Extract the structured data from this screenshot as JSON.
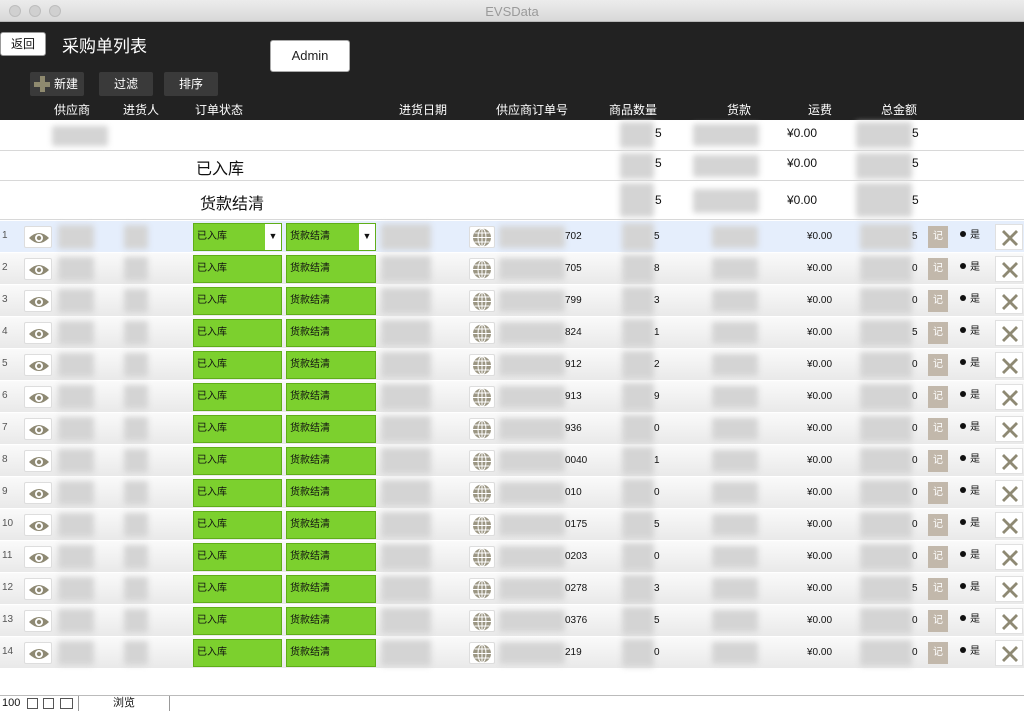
{
  "window": {
    "title": "EVSData"
  },
  "header": {
    "back_label": "返回",
    "page_title": "采购单列表",
    "admin_label": "Admin",
    "new_label": "新建",
    "filter_label": "过滤",
    "sort_label": "排序"
  },
  "columns": {
    "supplier": "供应商",
    "buyer": "进货人",
    "order_status": "订单状态",
    "date": "进货日期",
    "supplier_order_no": "供应商订单号",
    "qty": "商品数量",
    "payment": "货款",
    "freight": "运费",
    "total": "总金额"
  },
  "summary": [
    {
      "label": "",
      "qty_suffix": "5",
      "freight": "¥0.00",
      "total_suffix": "5"
    },
    {
      "label": "已入库",
      "qty_suffix": "5",
      "freight": "¥0.00",
      "total_suffix": "5"
    },
    {
      "label": "货款结清",
      "qty_suffix": "5",
      "freight": "¥0.00",
      "total_suffix": "5"
    }
  ],
  "rows": [
    {
      "num": "1",
      "status1": "已入库",
      "status2": "货款结清",
      "ordno": "702",
      "qty": "5",
      "freight": "¥0.00",
      "total": "5",
      "note": "记",
      "paid": "是"
    },
    {
      "num": "2",
      "status1": "已入库",
      "status2": "货款结清",
      "ordno": "705",
      "qty": "8",
      "freight": "¥0.00",
      "total": "0",
      "note": "记",
      "paid": "是"
    },
    {
      "num": "3",
      "status1": "已入库",
      "status2": "货款结清",
      "ordno": "799",
      "qty": "3",
      "freight": "¥0.00",
      "total": "0",
      "note": "记",
      "paid": "是"
    },
    {
      "num": "4",
      "status1": "已入库",
      "status2": "货款结清",
      "ordno": "824",
      "qty": "1",
      "freight": "¥0.00",
      "total": "5",
      "note": "记",
      "paid": "是"
    },
    {
      "num": "5",
      "status1": "已入库",
      "status2": "货款结清",
      "ordno": "912",
      "qty": "2",
      "freight": "¥0.00",
      "total": "0",
      "note": "记",
      "paid": "是"
    },
    {
      "num": "6",
      "status1": "已入库",
      "status2": "货款结清",
      "ordno": "913",
      "qty": "9",
      "freight": "¥0.00",
      "total": "0",
      "note": "记",
      "paid": "是"
    },
    {
      "num": "7",
      "status1": "已入库",
      "status2": "货款结清",
      "ordno": "936",
      "qty": "0",
      "freight": "¥0.00",
      "total": "0",
      "note": "记",
      "paid": "是"
    },
    {
      "num": "8",
      "status1": "已入库",
      "status2": "货款结清",
      "ordno": "0040",
      "qty": "1",
      "freight": "¥0.00",
      "total": "0",
      "note": "记",
      "paid": "是"
    },
    {
      "num": "9",
      "status1": "已入库",
      "status2": "货款结清",
      "ordno": "010",
      "qty": "0",
      "freight": "¥0.00",
      "total": "0",
      "note": "记",
      "paid": "是"
    },
    {
      "num": "10",
      "status1": "已入库",
      "status2": "货款结清",
      "ordno": "0175",
      "qty": "5",
      "freight": "¥0.00",
      "total": "0",
      "note": "记",
      "paid": "是"
    },
    {
      "num": "11",
      "status1": "已入库",
      "status2": "货款结清",
      "ordno": "0203",
      "qty": "0",
      "freight": "¥0.00",
      "total": "0",
      "note": "记",
      "paid": "是"
    },
    {
      "num": "12",
      "status1": "已入库",
      "status2": "货款结清",
      "ordno": "0278",
      "qty": "3",
      "freight": "¥0.00",
      "total": "5",
      "note": "记",
      "paid": "是"
    },
    {
      "num": "13",
      "status1": "已入库",
      "status2": "货款结清",
      "ordno": "0376",
      "qty": "5",
      "freight": "¥0.00",
      "total": "0",
      "note": "记",
      "paid": "是"
    },
    {
      "num": "14",
      "status1": "已入库",
      "status2": "货款结清",
      "ordno": "219",
      "qty": "0",
      "freight": "¥0.00",
      "total": "0",
      "note": "记",
      "paid": "是"
    }
  ],
  "footer": {
    "count": "100",
    "mode": "浏览"
  },
  "icons": {
    "view": "eye-icon",
    "link": "globe-icon",
    "delete": "close-icon",
    "add": "plus-icon"
  },
  "colors": {
    "status_green": "#7cd02e",
    "header_bg": "#222222"
  }
}
